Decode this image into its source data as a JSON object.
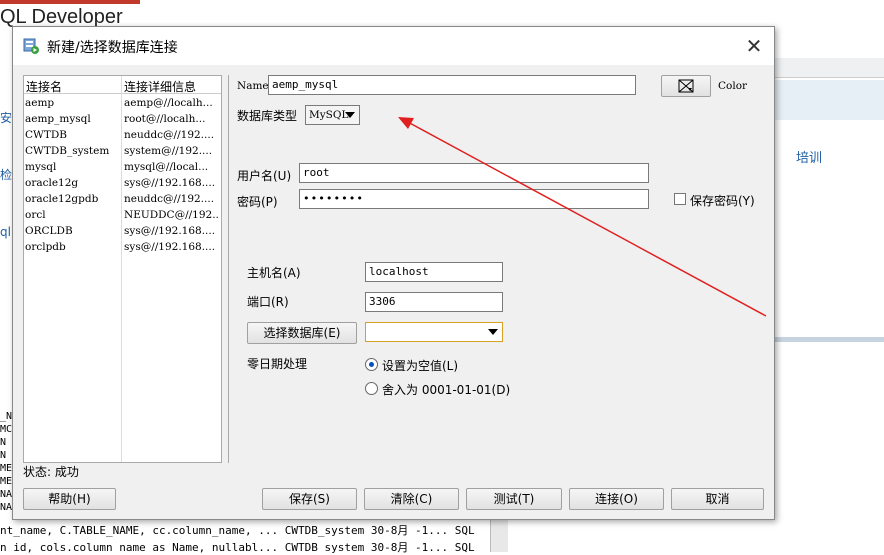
{
  "background": {
    "app_title": "QL Developer",
    "training_link": "培训",
    "left_fragments": "安\n检\nql",
    "bottom_rows": [
      "nt_name, C.TABLE_NAME, cc.column_name, ... CWTDB_system 30-8月 -1... SQL",
      "n id, cols.column name as Name, nullabl... CWTDB system 30-8月 -1... SQL"
    ],
    "left_row_frags": "_N\nMC\nN\nN\nME,\nME\nNAME,\nNAME,"
  },
  "dialog": {
    "title": "新建/选择数据库连接",
    "close": "✕",
    "list_headers": [
      "连接名",
      "连接详细信息"
    ],
    "connections": [
      {
        "name": "aemp",
        "detail": "aemp@//localh..."
      },
      {
        "name": "aemp_mysql",
        "detail": "root@//localh..."
      },
      {
        "name": "CWTDB",
        "detail": "neuddc@//192...."
      },
      {
        "name": "CWTDB_system",
        "detail": "system@//192...."
      },
      {
        "name": "mysql",
        "detail": "mysql@//local..."
      },
      {
        "name": "oracle12g",
        "detail": "sys@//192.168...."
      },
      {
        "name": "oracle12gpdb",
        "detail": "neuddc@//192...."
      },
      {
        "name": "orcl",
        "detail": "NEUDDC@//192...."
      },
      {
        "name": "ORCLDB",
        "detail": "sys@//192.168...."
      },
      {
        "name": "orclpdb",
        "detail": "sys@//192.168...."
      }
    ],
    "status": "状态: 成功",
    "form": {
      "name_label": "Name",
      "name_value": "aemp_mysql",
      "color_label": "Color",
      "dbtype_label": "数据库类型",
      "dbtype_value": "MySQL",
      "username_label": "用户名(U)",
      "username_value": "root",
      "password_label": "密码(P)",
      "password_value": "••••••••",
      "save_password_label": "保存密码(Y)",
      "host_label": "主机名(A)",
      "host_value": "localhost",
      "port_label": "端口(R)",
      "port_value": "3306",
      "choose_db_button": "选择数据库(E)",
      "choose_db_value": "",
      "zero_date_label": "零日期处理",
      "option_null": "设置为空值(L)",
      "option_round": "舍入为 0001-01-01(D)"
    },
    "buttons": {
      "help": "帮助(H)",
      "save": "保存(S)",
      "clear": "清除(C)",
      "test": "测试(T)",
      "connect": "连接(O)",
      "cancel": "取消"
    }
  }
}
